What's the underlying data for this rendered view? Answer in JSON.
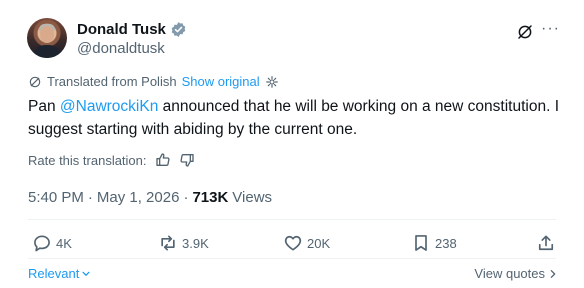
{
  "author": {
    "display_name": "Donald Tusk",
    "handle": "@donaldtusk",
    "verified": true
  },
  "translation": {
    "label": "Translated from Polish",
    "show_original": "Show original",
    "rate_label": "Rate this translation:"
  },
  "tweet": {
    "prefix": "Pan ",
    "mention": "@NawrockiKn",
    "suffix": " announced that he will be working on a new constitution. I suggest starting with abiding by the current one."
  },
  "meta": {
    "time": "5:40 PM",
    "sep1": "·",
    "date": "May 1, 2026",
    "sep2": "·",
    "views_count": "713K",
    "views_label": "Views"
  },
  "actions": {
    "replies": "4K",
    "reposts": "3.9K",
    "likes": "20K",
    "bookmarks": "238"
  },
  "footer": {
    "sort_label": "Relevant",
    "view_quotes": "View quotes"
  },
  "colors": {
    "accent": "#1d9bf0",
    "text": "#0f1419",
    "secondary": "#536471",
    "border": "#eff3f4"
  }
}
